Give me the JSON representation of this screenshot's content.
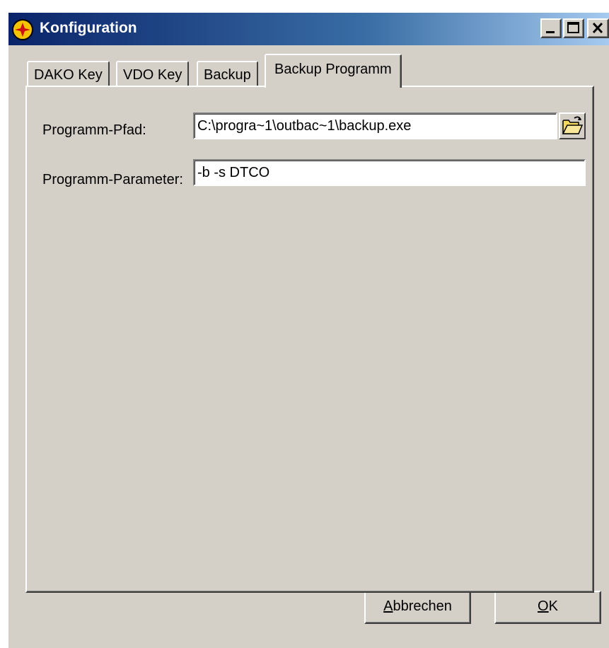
{
  "window": {
    "title": "Konfiguration",
    "colors": {
      "titlebar_start": "#0a246a",
      "titlebar_end": "#a6caf0",
      "face": "#d4d0c8"
    }
  },
  "tabs": [
    {
      "label": "DAKO Key",
      "active": false
    },
    {
      "label": "VDO Key",
      "active": false
    },
    {
      "label": "Backup",
      "active": false
    },
    {
      "label": "Backup Programm",
      "active": true
    }
  ],
  "form": {
    "path_label": "Programm-Pfad:",
    "path_value": "C:\\progra~1\\outbac~1\\backup.exe",
    "params_label": "Programm-Parameter:",
    "params_value": "-b -s DTCO",
    "browse_icon": "open-folder-icon"
  },
  "buttons": {
    "cancel_label": "Abbrechen",
    "cancel_mnemonic": "A",
    "ok_label": "OK",
    "ok_mnemonic": "O"
  }
}
